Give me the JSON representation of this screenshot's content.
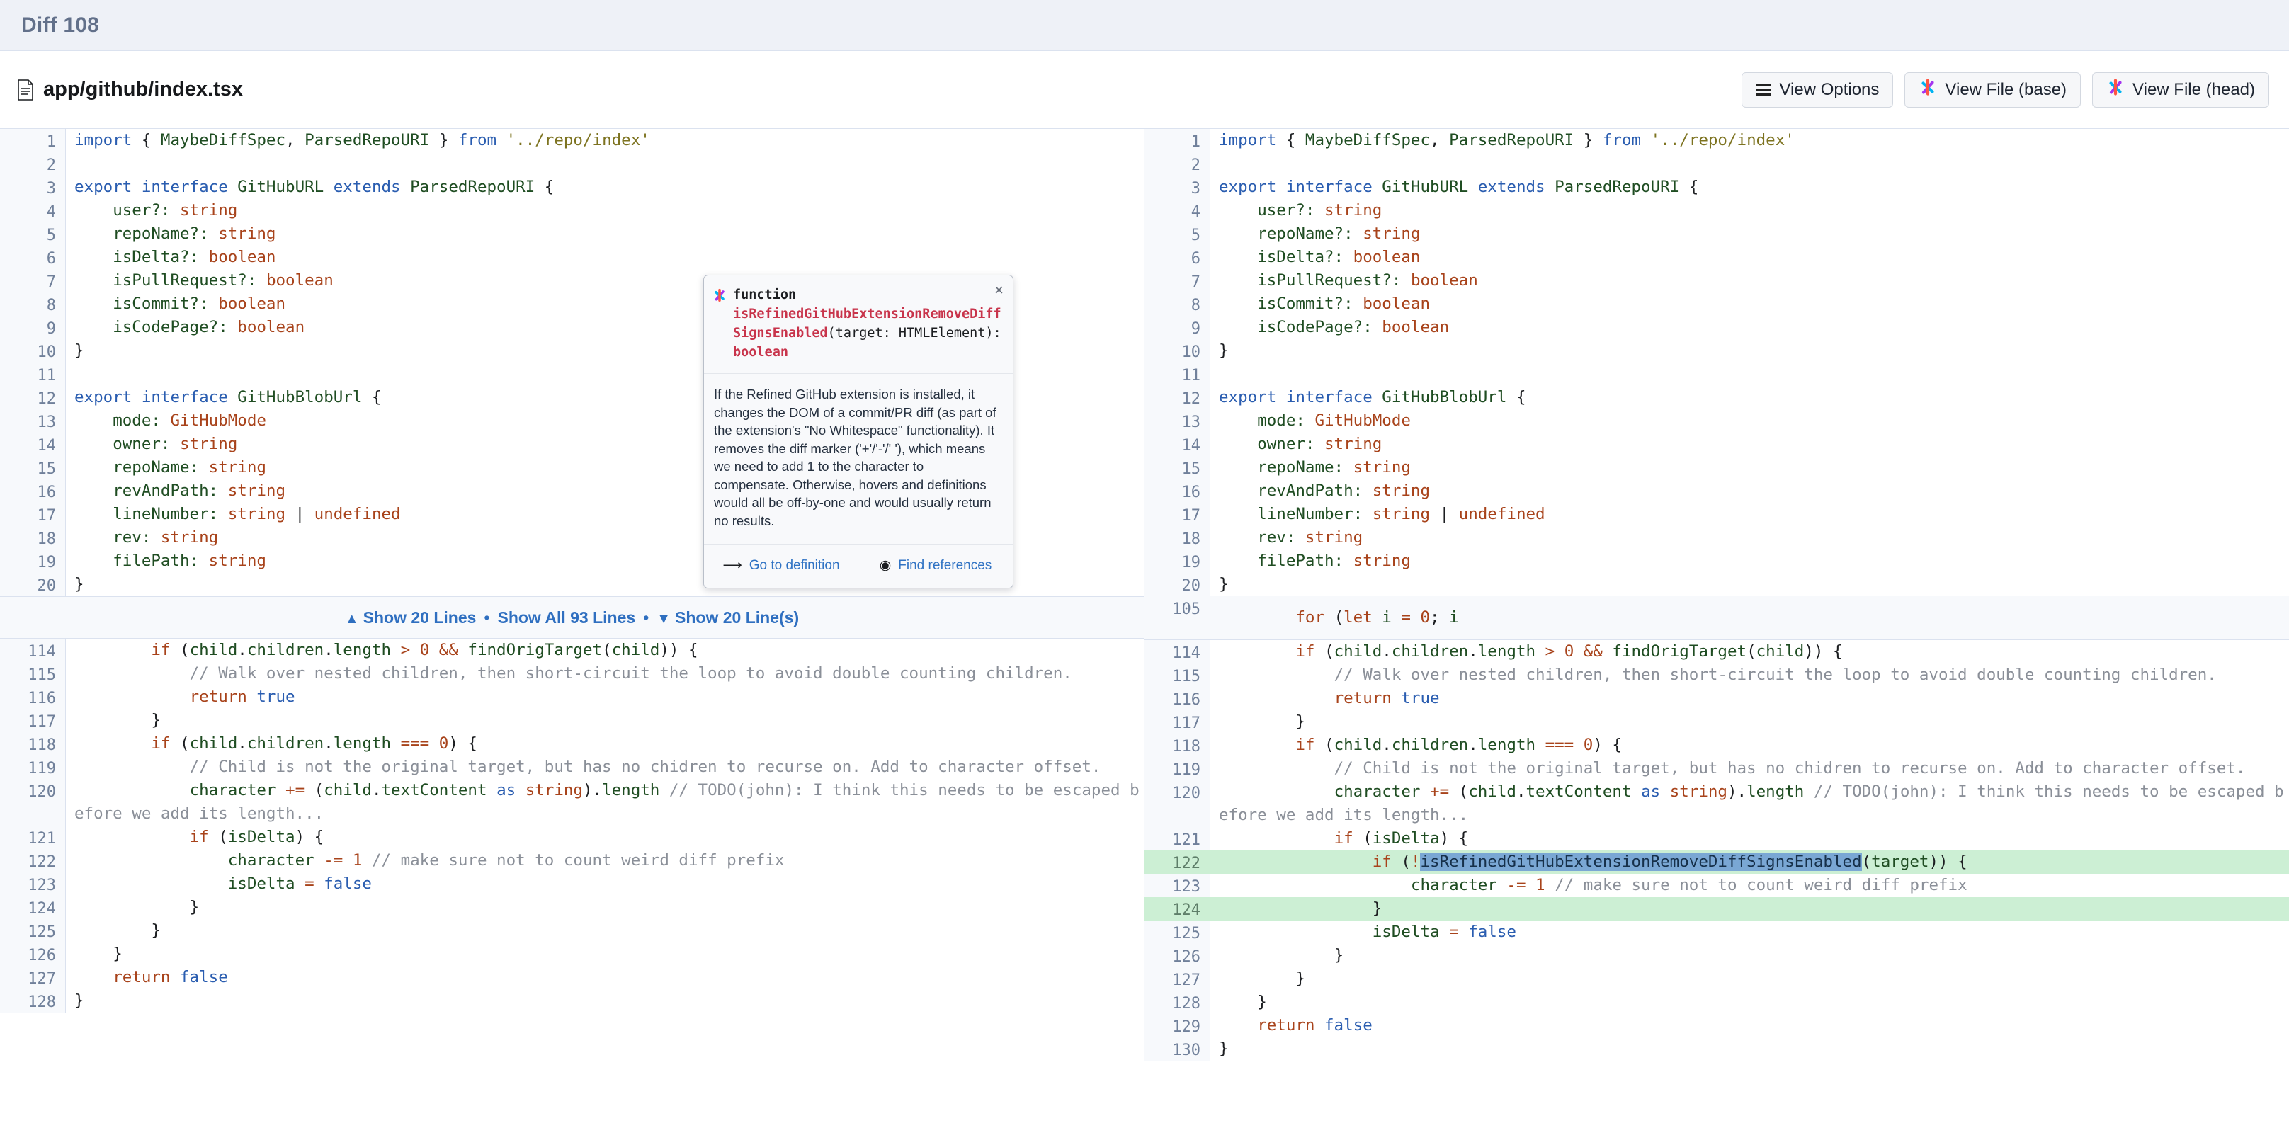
{
  "topbar": {
    "title": "Diff 108"
  },
  "fileheader": {
    "filename": "app/github/index.tsx",
    "buttons": [
      {
        "label": "View Options",
        "icon": "hamburger-icon"
      },
      {
        "label": "View File (base)",
        "icon": "sourcegraph-icon"
      },
      {
        "label": "View File (head)",
        "icon": "sourcegraph-icon"
      }
    ]
  },
  "expander": {
    "up_label": "Show 20 Lines",
    "all_label": "Show All 93 Lines",
    "down_label": "Show 20 Line(s)",
    "up_arrow": "▲",
    "down_arrow": "▼",
    "separator": "•"
  },
  "popover": {
    "kind": "function",
    "name": "isRefinedGitHubExtensionRemoveDiffSignsEnabled",
    "args": "(target: HTMLElement): ",
    "return_type": "boolean",
    "doc": "If the Refined GitHub extension is installed, it changes the DOM of a commit/PR diff (as part of the extension's\n\"No Whitespace\" functionality). It removes the diff marker ('+'/'-'/' '), which means we need to add 1 to the\ncharacter to compensate. Otherwise, hovers and definitions would all be off-by-one and would usually return no\nresults.",
    "close_label": "×",
    "actions": [
      {
        "label": "Go to definition",
        "icon": "arrow-curve-icon"
      },
      {
        "label": "Find references",
        "icon": "eye-target-icon"
      }
    ]
  },
  "colors": {
    "added_bg": "#ccefd4",
    "gutter_bg": "#f7f9fc",
    "link": "#3073c4",
    "popover_name": "#c8344b",
    "token_highlight": "#7aa7d4"
  },
  "left_pane": {
    "hunk_line": null,
    "rows": [
      {
        "n": "1",
        "html": "<span class=\"kw\">import</span> <span class=\"pl\">{</span> <span class=\"id\">MaybeDiffSpec</span><span class=\"pl\">,</span> <span class=\"id\">ParsedRepoURI</span> <span class=\"pl\">}</span> <span class=\"kw\">from</span> <span class=\"str\">'../repo/index'</span>"
      },
      {
        "n": "2",
        "html": ""
      },
      {
        "n": "3",
        "html": "<span class=\"kw\">export</span> <span class=\"kw\">interface</span> <span class=\"id\">GitHubURL</span> <span class=\"kw\">extends</span> <span class=\"id\">ParsedRepoURI</span> <span class=\"pl\">{</span>"
      },
      {
        "n": "4",
        "html": "    <span class=\"id\">user?:</span> <span class=\"typ\">string</span>"
      },
      {
        "n": "5",
        "html": "    <span class=\"id\">repoName?:</span> <span class=\"typ\">string</span>"
      },
      {
        "n": "6",
        "html": "    <span class=\"id\">isDelta?:</span> <span class=\"typ\">boolean</span>"
      },
      {
        "n": "7",
        "html": "    <span class=\"id\">isPullRequest?:</span> <span class=\"typ\">boolean</span>"
      },
      {
        "n": "8",
        "html": "    <span class=\"id\">isCommit?:</span> <span class=\"typ\">boolean</span>"
      },
      {
        "n": "9",
        "html": "    <span class=\"id\">isCodePage?:</span> <span class=\"typ\">boolean</span>"
      },
      {
        "n": "10",
        "html": "<span class=\"pl\">}</span>"
      },
      {
        "n": "11",
        "html": ""
      },
      {
        "n": "12",
        "html": "<span class=\"kw\">export</span> <span class=\"kw\">interface</span> <span class=\"id\">GitHubBlobUrl</span> <span class=\"pl\">{</span>"
      },
      {
        "n": "13",
        "html": "    <span class=\"id\">mode:</span> <span class=\"typ\">GitHubMode</span>"
      },
      {
        "n": "14",
        "html": "    <span class=\"id\">owner:</span> <span class=\"typ\">string</span>"
      },
      {
        "n": "15",
        "html": "    <span class=\"id\">repoName:</span> <span class=\"typ\">string</span>"
      },
      {
        "n": "16",
        "html": "    <span class=\"id\">revAndPath:</span> <span class=\"typ\">string</span>"
      },
      {
        "n": "17",
        "html": "    <span class=\"id\">lineNumber:</span> <span class=\"typ\">string</span> <span class=\"pl\">|</span> <span class=\"typ\">undefined</span>"
      },
      {
        "n": "18",
        "html": "    <span class=\"id\">rev:</span> <span class=\"typ\">string</span>"
      },
      {
        "n": "19",
        "html": "    <span class=\"id\">filePath:</span> <span class=\"typ\">string</span>"
      },
      {
        "n": "20",
        "html": "<span class=\"pl\">}</span>"
      }
    ],
    "rows_after": [
      {
        "n": "114",
        "html": "        <span class=\"kw2\">if</span> <span class=\"pl\">(</span><span class=\"id\">child</span><span class=\"pl\">.</span><span class=\"id\">children</span><span class=\"pl\">.</span><span class=\"id\">length</span> <span class=\"op\">&gt;</span> <span class=\"num-lit\">0</span> <span class=\"op\">&amp;&amp;</span> <span class=\"id\">findOrigTarget</span><span class=\"pl\">(</span><span class=\"id\">child</span><span class=\"pl\">))</span> <span class=\"pl\">{</span>",
        "add": false
      },
      {
        "n": "115",
        "html": "            <span class=\"cmt\">// Walk over nested children, then short-circuit the loop to avoid double counting children.</span>",
        "add": false
      },
      {
        "n": "116",
        "html": "            <span class=\"kw2\">return</span> <span class=\"kw\">true</span>",
        "add": false
      },
      {
        "n": "117",
        "html": "        <span class=\"pl\">}</span>",
        "add": false
      },
      {
        "n": "118",
        "html": "        <span class=\"kw2\">if</span> <span class=\"pl\">(</span><span class=\"id\">child</span><span class=\"pl\">.</span><span class=\"id\">children</span><span class=\"pl\">.</span><span class=\"id\">length</span> <span class=\"op\">===</span> <span class=\"num-lit\">0</span><span class=\"pl\">)</span> <span class=\"pl\">{</span>",
        "add": false
      },
      {
        "n": "119",
        "html": "            <span class=\"cmt\">// Child is not the original target, but has no chidren to recurse on. Add to character offset.</span>",
        "add": false
      },
      {
        "n": "120",
        "html": "            <span class=\"id\">character</span> <span class=\"op\">+=</span> <span class=\"pl\">(</span><span class=\"id\">child</span><span class=\"pl\">.</span><span class=\"id\">textContent</span> <span class=\"kw\">as</span> <span class=\"typ\">string</span><span class=\"pl\">)</span><span class=\"pl\">.</span><span class=\"id\">length</span> <span class=\"cmt\">// TODO(john): I think this needs to be escaped before we add its length...</span>",
        "add": false
      },
      {
        "n": "121",
        "html": "            <span class=\"kw2\">if</span> <span class=\"pl\">(</span><span class=\"id\">isDelta</span><span class=\"pl\">)</span> <span class=\"pl\">{</span>",
        "add": false
      },
      {
        "n": "122",
        "html": "                <span class=\"id\">character</span> <span class=\"op\">-=</span> <span class=\"num-lit\">1</span> <span class=\"cmt\">// make sure not to count weird diff prefix</span>",
        "add": false
      },
      {
        "n": "123",
        "html": "                <span class=\"id\">isDelta</span> <span class=\"op\">=</span> <span class=\"kw\">false</span>",
        "add": false
      },
      {
        "n": "124",
        "html": "            <span class=\"pl\">}</span>",
        "add": false
      },
      {
        "n": "125",
        "html": "        <span class=\"pl\">}</span>",
        "add": false
      },
      {
        "n": "126",
        "html": "    <span class=\"pl\">}</span>",
        "add": false
      },
      {
        "n": "127",
        "html": "    <span class=\"kw2\">return</span> <span class=\"kw\">false</span>",
        "add": false
      },
      {
        "n": "128",
        "html": "<span class=\"pl\">}</span>",
        "add": false
      }
    ]
  },
  "right_pane": {
    "hunk_line": {
      "n": "105",
      "html": "        <span class=\"kw2\">for</span> <span class=\"pl\">(</span><span class=\"kw2\">let</span> <span class=\"id\">i</span> <span class=\"op\">=</span> <span class=\"num-lit\">0</span><span class=\"pl\">;</span> <span class=\"id\">i</span>"
    },
    "rows": [
      {
        "n": "1",
        "html": "<span class=\"kw\">import</span> <span class=\"pl\">{</span> <span class=\"id\">MaybeDiffSpec</span><span class=\"pl\">,</span> <span class=\"id\">ParsedRepoURI</span> <span class=\"pl\">}</span> <span class=\"kw\">from</span> <span class=\"str\">'../repo/index'</span>"
      },
      {
        "n": "2",
        "html": ""
      },
      {
        "n": "3",
        "html": "<span class=\"kw\">export</span> <span class=\"kw\">interface</span> <span class=\"id\">GitHubURL</span> <span class=\"kw\">extends</span> <span class=\"id\">ParsedRepoURI</span> <span class=\"pl\">{</span>"
      },
      {
        "n": "4",
        "html": "    <span class=\"id\">user?:</span> <span class=\"typ\">string</span>"
      },
      {
        "n": "5",
        "html": "    <span class=\"id\">repoName?:</span> <span class=\"typ\">string</span>"
      },
      {
        "n": "6",
        "html": "    <span class=\"id\">isDelta?:</span> <span class=\"typ\">boolean</span>"
      },
      {
        "n": "7",
        "html": "    <span class=\"id\">isPullRequest?:</span> <span class=\"typ\">boolean</span>"
      },
      {
        "n": "8",
        "html": "    <span class=\"id\">isCommit?:</span> <span class=\"typ\">boolean</span>"
      },
      {
        "n": "9",
        "html": "    <span class=\"id\">isCodePage?:</span> <span class=\"typ\">boolean</span>"
      },
      {
        "n": "10",
        "html": "<span class=\"pl\">}</span>"
      },
      {
        "n": "11",
        "html": ""
      },
      {
        "n": "12",
        "html": "<span class=\"kw\">export</span> <span class=\"kw\">interface</span> <span class=\"id\">GitHubBlobUrl</span> <span class=\"pl\">{</span>"
      },
      {
        "n": "13",
        "html": "    <span class=\"id\">mode:</span> <span class=\"typ\">GitHubMode</span>"
      },
      {
        "n": "14",
        "html": "    <span class=\"id\">owner:</span> <span class=\"typ\">string</span>"
      },
      {
        "n": "15",
        "html": "    <span class=\"id\">repoName:</span> <span class=\"typ\">string</span>"
      },
      {
        "n": "16",
        "html": "    <span class=\"id\">revAndPath:</span> <span class=\"typ\">string</span>"
      },
      {
        "n": "17",
        "html": "    <span class=\"id\">lineNumber:</span> <span class=\"typ\">string</span> <span class=\"pl\">|</span> <span class=\"typ\">undefined</span>"
      },
      {
        "n": "18",
        "html": "    <span class=\"id\">rev:</span> <span class=\"typ\">string</span>"
      },
      {
        "n": "19",
        "html": "    <span class=\"id\">filePath:</span> <span class=\"typ\">string</span>"
      },
      {
        "n": "20",
        "html": "<span class=\"pl\">}</span>"
      }
    ],
    "rows_after": [
      {
        "n": "114",
        "html": "        <span class=\"kw2\">if</span> <span class=\"pl\">(</span><span class=\"id\">child</span><span class=\"pl\">.</span><span class=\"id\">children</span><span class=\"pl\">.</span><span class=\"id\">length</span> <span class=\"op\">&gt;</span> <span class=\"num-lit\">0</span> <span class=\"op\">&amp;&amp;</span> <span class=\"id\">findOrigTarget</span><span class=\"pl\">(</span><span class=\"id\">child</span><span class=\"pl\">))</span> <span class=\"pl\">{</span>",
        "add": false
      },
      {
        "n": "115",
        "html": "            <span class=\"cmt\">// Walk over nested children, then short-circuit the loop to avoid double counting children.</span>",
        "add": false
      },
      {
        "n": "116",
        "html": "            <span class=\"kw2\">return</span> <span class=\"kw\">true</span>",
        "add": false
      },
      {
        "n": "117",
        "html": "        <span class=\"pl\">}</span>",
        "add": false
      },
      {
        "n": "118",
        "html": "        <span class=\"kw2\">if</span> <span class=\"pl\">(</span><span class=\"id\">child</span><span class=\"pl\">.</span><span class=\"id\">children</span><span class=\"pl\">.</span><span class=\"id\">length</span> <span class=\"op\">===</span> <span class=\"num-lit\">0</span><span class=\"pl\">)</span> <span class=\"pl\">{</span>",
        "add": false
      },
      {
        "n": "119",
        "html": "            <span class=\"cmt\">// Child is not the original target, but has no chidren to recurse on. Add to character offset.</span>",
        "add": false
      },
      {
        "n": "120",
        "html": "            <span class=\"id\">character</span> <span class=\"op\">+=</span> <span class=\"pl\">(</span><span class=\"id\">child</span><span class=\"pl\">.</span><span class=\"id\">textContent</span> <span class=\"kw\">as</span> <span class=\"typ\">string</span><span class=\"pl\">)</span><span class=\"pl\">.</span><span class=\"id\">length</span> <span class=\"cmt\">// TODO(john): I think this needs to be escaped before we add its length...</span>",
        "add": false
      },
      {
        "n": "121",
        "html": "            <span class=\"kw2\">if</span> <span class=\"pl\">(</span><span class=\"id\">isDelta</span><span class=\"pl\">)</span> <span class=\"pl\">{</span>",
        "add": false
      },
      {
        "n": "122",
        "html": "                <span class=\"kw2\">if</span> <span class=\"pl\">(</span><span class=\"op\">!</span><span class=\"hl\">isRefinedGitHubExtensionRemoveDiffSignsEnabled</span><span class=\"pl\">(</span><span class=\"id\">target</span><span class=\"pl\">))</span> <span class=\"pl\">{</span>",
        "add": true
      },
      {
        "n": "123",
        "html": "                    <span class=\"id\">character</span> <span class=\"op\">-=</span> <span class=\"num-lit\">1</span> <span class=\"cmt\">// make sure not to count weird diff prefix</span>",
        "add": false
      },
      {
        "n": "124",
        "html": "                <span class=\"pl\">}</span>",
        "add": true
      },
      {
        "n": "125",
        "html": "                <span class=\"id\">isDelta</span> <span class=\"op\">=</span> <span class=\"kw\">false</span>",
        "add": false
      },
      {
        "n": "126",
        "html": "            <span class=\"pl\">}</span>",
        "add": false
      },
      {
        "n": "127",
        "html": "        <span class=\"pl\">}</span>",
        "add": false
      },
      {
        "n": "128",
        "html": "    <span class=\"pl\">}</span>",
        "add": false
      },
      {
        "n": "129",
        "html": "    <span class=\"kw2\">return</span> <span class=\"kw\">false</span>",
        "add": false
      },
      {
        "n": "130",
        "html": "<span class=\"pl\">}</span>",
        "add": false
      }
    ]
  }
}
